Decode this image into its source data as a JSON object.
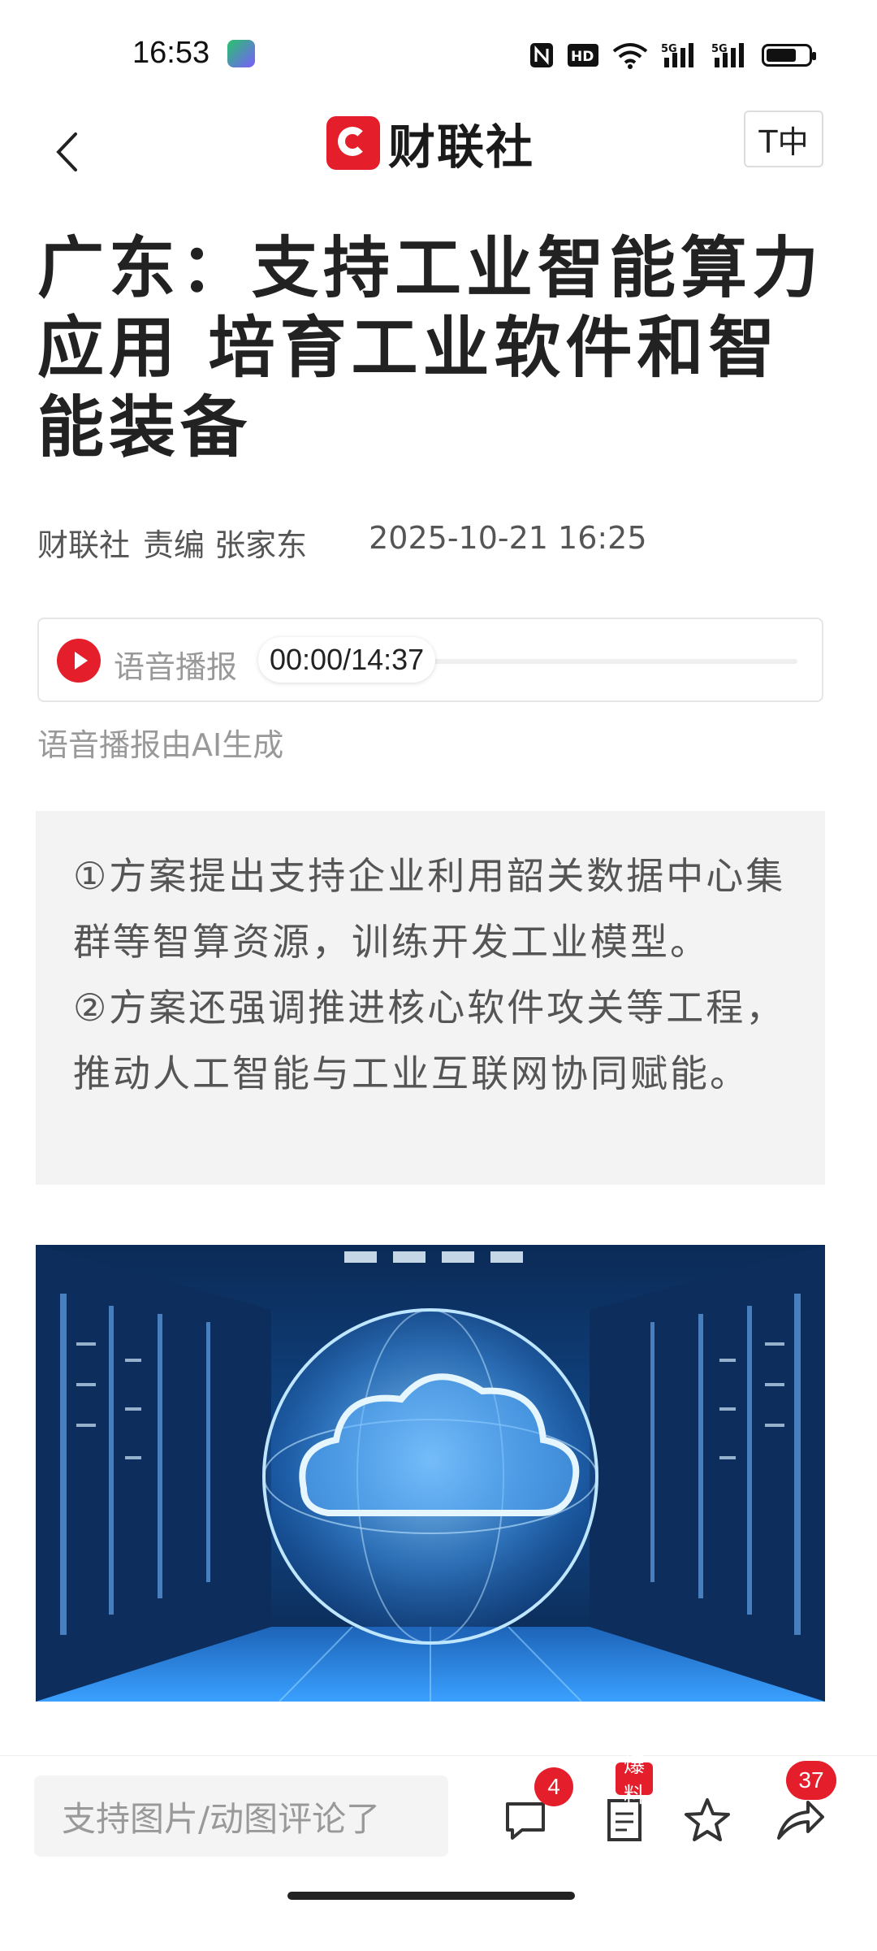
{
  "status_bar": {
    "time": "16:53",
    "icons": [
      "app-badge-icon",
      "nfc-icon",
      "hd-icon",
      "wifi-icon",
      "signal-5g-icon",
      "signal-5g-icon",
      "battery-icon"
    ],
    "battery_level": 0.7
  },
  "header": {
    "back_icon": "chevron-left-icon",
    "logo_text": "财联社",
    "font_button": "T中"
  },
  "article": {
    "title": "广东：支持工业智能算力应用 培育工业软件和智能装备",
    "source": "财联社",
    "editor": "责编 张家东",
    "datetime": "2025-10-21 16:25",
    "audio": {
      "label": "语音播报",
      "time": "00:00/14:37",
      "progress": 0,
      "ai_note": "语音播报由AI生成"
    },
    "summary": [
      "①方案提出支持企业利用韶关数据中心集群等智算资源，训练开发工业模型。",
      "②方案还强调推进核心软件攻关等工程，推动人工智能与工业互联网协同赋能。"
    ],
    "image_subject": "cloud-in-data-center-illustration"
  },
  "bottom_bar": {
    "comment_placeholder": "支持图片/动图评论了",
    "comment_count": "4",
    "report_tag": "爆料",
    "share_count": "37",
    "icons": [
      "comment-icon",
      "report-icon",
      "star-icon",
      "share-icon"
    ]
  },
  "colors": {
    "brand_red": "#e41e2a",
    "summary_bg": "#f3f3f3"
  }
}
